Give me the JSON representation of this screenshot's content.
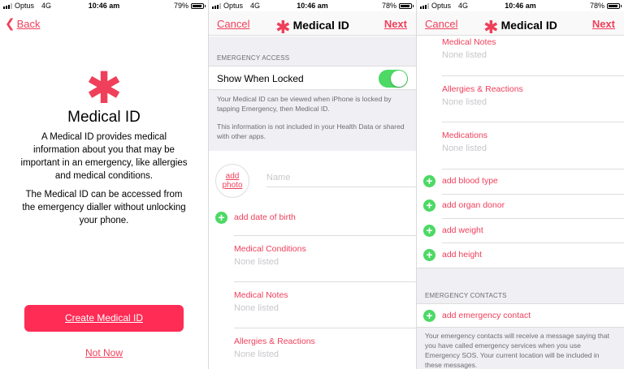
{
  "status_bar": {
    "carrier": "Optus",
    "network": "4G",
    "time": "10:46 am",
    "battery_left": "79%",
    "battery_middle": "78%",
    "battery_right": "78%"
  },
  "screen1": {
    "back_label": "Back",
    "back_icon": "chevron-left-icon",
    "asterisk": "✱",
    "title": "Medical ID",
    "description": "A Medical ID provides medical information about you that may be important in an emergency, like allergies and medical conditions.",
    "note": "The Medical ID can be accessed from the emergency dialler without unlocking your phone.",
    "create_button": "Create Medical ID",
    "not_now": "Not Now"
  },
  "screen2": {
    "cancel": "Cancel",
    "title": "Medical ID",
    "next": "Next",
    "emergency_access_header": "EMERGENCY ACCESS",
    "show_when_locked_label": "Show When Locked",
    "show_when_locked_on": true,
    "info_1": "Your Medical ID can be viewed when iPhone is locked by tapping Emergency, then Medical ID.",
    "info_2": "This information is not included in your Health Data or shared with other apps.",
    "add_photo": "add photo",
    "name_placeholder": "Name",
    "add_date_of_birth": "add date of birth",
    "fields": [
      {
        "label": "Medical Conditions",
        "value": "None listed"
      },
      {
        "label": "Medical Notes",
        "value": "None listed"
      },
      {
        "label": "Allergies & Reactions",
        "value": "None listed"
      }
    ]
  },
  "screen3": {
    "cancel": "Cancel",
    "title": "Medical ID",
    "next": "Next",
    "fields": [
      {
        "label": "Medical Notes",
        "value": "None listed"
      },
      {
        "label": "Allergies & Reactions",
        "value": "None listed"
      },
      {
        "label": "Medications",
        "value": "None listed"
      }
    ],
    "add_items": [
      "add blood type",
      "add organ donor",
      "add weight",
      "add height"
    ],
    "emergency_contacts_header": "EMERGENCY CONTACTS",
    "add_emergency_contact": "add emergency contact",
    "contacts_info": "Your emergency contacts will receive a message saying that you have called emergency services when you use Emergency SOS. Your current location will be included in these messages."
  },
  "colors": {
    "accent": "#ef3f5a",
    "button": "#ff2c55",
    "toggle_on": "#4cd964",
    "group_bg": "#efeff4"
  }
}
